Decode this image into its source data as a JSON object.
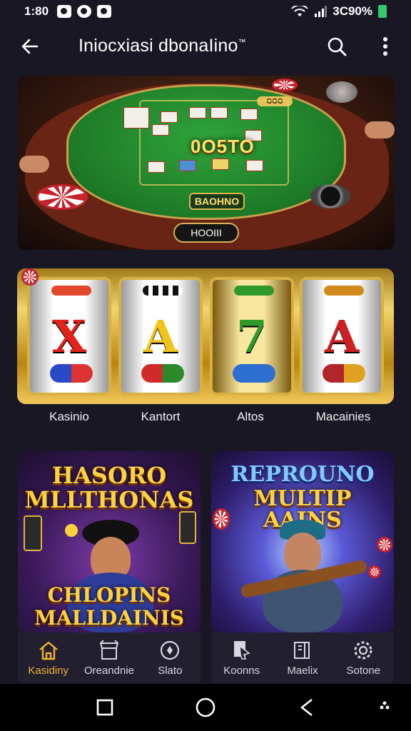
{
  "status_bar": {
    "time": "1:80",
    "battery_text": "3C90%"
  },
  "app_bar": {
    "title": "Iniocxiasi dbonaIino",
    "title_mark": "™"
  },
  "banner": {
    "felt_score": "0O5TO",
    "felt_sign": "BAOHNO",
    "felt_top_label": "OOO",
    "button_label": "HOOIII"
  },
  "slots": {
    "reels": [
      {
        "symbol": "X",
        "color": "#e2231a"
      },
      {
        "symbol": "A",
        "color": "#f0c419"
      },
      {
        "symbol": "7",
        "color": "#2f9a2b"
      },
      {
        "symbol": "A",
        "color": "#d01f23"
      }
    ],
    "labels": [
      "Kasinio",
      "Kantort",
      "Altos",
      "Macainies"
    ]
  },
  "promos": {
    "left": {
      "title_top": "HASORO",
      "title_mid": "MLLTHONAS",
      "title_bottom_1": "CHLOPINS",
      "title_bottom_2": "MALLDAINIS"
    },
    "right": {
      "title_top": "REPROUNO",
      "title_mid": "MULTIP AAINS"
    }
  },
  "bottom_nav": {
    "left": [
      {
        "label": "Kasidiny",
        "icon": "home-icon",
        "active": true
      },
      {
        "label": "Oreandnie",
        "icon": "store-icon",
        "active": false
      },
      {
        "label": "Slato",
        "icon": "compass-icon",
        "active": false
      }
    ],
    "right": [
      {
        "label": "Koonns",
        "icon": "docs-icon",
        "active": false
      },
      {
        "label": "Maelix",
        "icon": "book-icon",
        "active": false
      },
      {
        "label": "Sotone",
        "icon": "gear-icon",
        "active": false
      }
    ]
  },
  "colors": {
    "accent": "#f2b233",
    "background": "#1a1724",
    "nav_bg": "#221f2f"
  }
}
